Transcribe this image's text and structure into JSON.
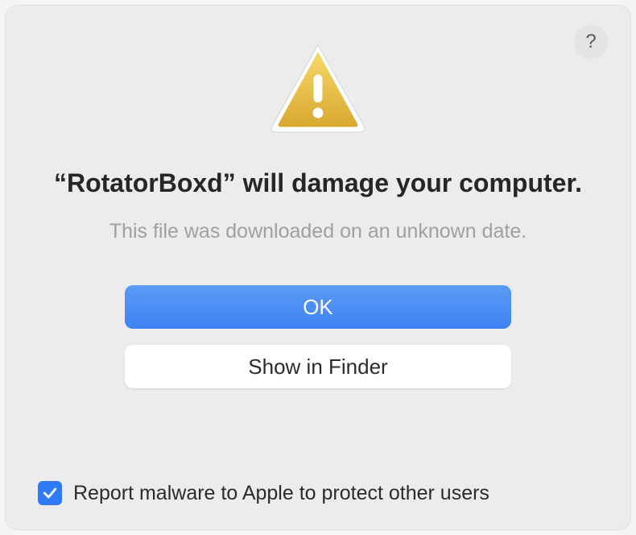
{
  "help": {
    "label": "?"
  },
  "alert": {
    "title": "“RotatorBoxd” will damage your computer.",
    "subtitle": "This file was downloaded on an unknown date."
  },
  "buttons": {
    "primary": "OK",
    "secondary": "Show in Finder"
  },
  "checkbox": {
    "checked": true,
    "label": "Report malware to Apple to protect other users"
  }
}
